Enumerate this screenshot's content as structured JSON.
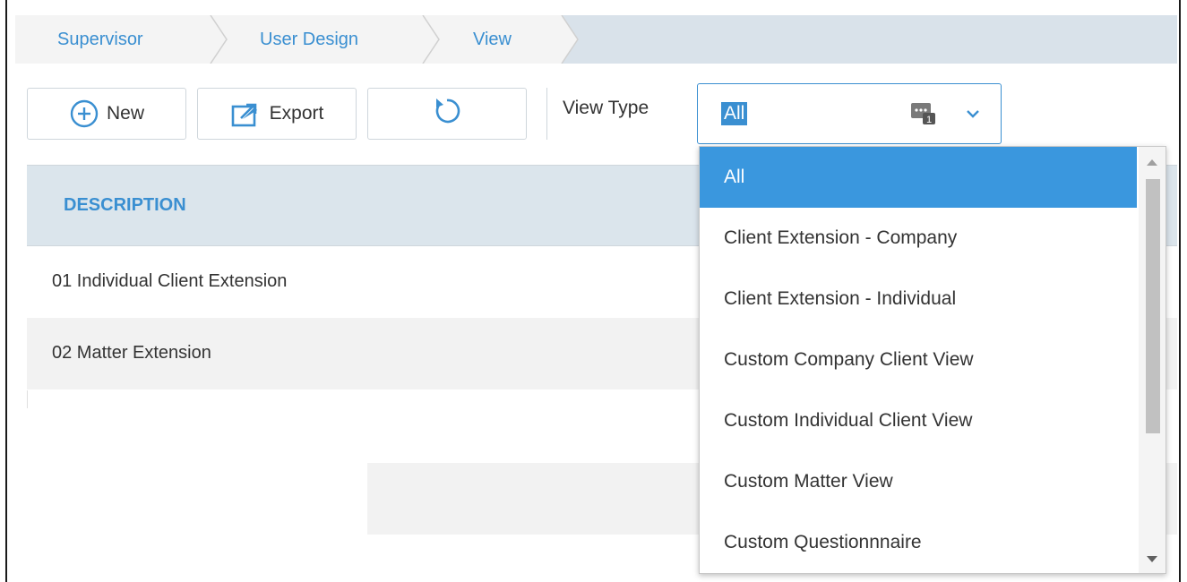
{
  "breadcrumb": {
    "items": [
      "Supervisor",
      "User Design",
      "View"
    ]
  },
  "toolbar": {
    "new_label": "New",
    "export_label": "Export",
    "view_type_label": "View Type",
    "view_type_value": "All"
  },
  "table": {
    "header": "DESCRIPTION",
    "rows": [
      "01 Individual Client Extension",
      "02 Matter Extension"
    ]
  },
  "dropdown": {
    "options": [
      "All",
      "Client Extension - Company",
      "Client Extension - Individual",
      "Custom Company Client View",
      "Custom Individual Client View",
      "Custom Matter View",
      "Custom Questionnnaire"
    ],
    "selected_index": 0
  },
  "colors": {
    "accent": "#3a8fd1",
    "selected": "#3a97de",
    "header_bg": "#dbe5ec",
    "breadcrumb_bg": "#d9e2ea"
  },
  "icons": [
    "plus-circle-icon",
    "export-icon",
    "refresh-icon",
    "chat-badge-icon",
    "chevron-down-icon"
  ]
}
